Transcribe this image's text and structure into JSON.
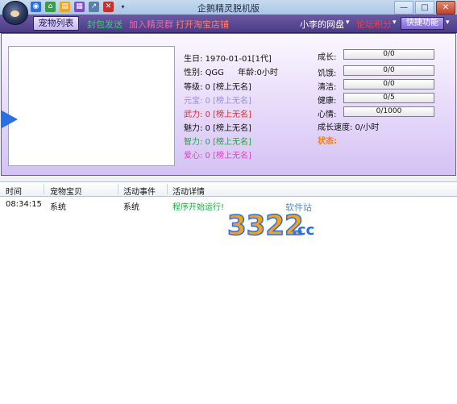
{
  "window": {
    "title": "企鹅精灵脱机版",
    "controls": {
      "minimize": "—",
      "maximize": "□",
      "close": "✕"
    }
  },
  "quick_icons": [
    "globe-icon",
    "home-icon",
    "document-icon",
    "stats-icon",
    "shortcut-icon",
    "close-app-icon",
    "dropdown-icon"
  ],
  "menu": {
    "active_tab": "宠物列表",
    "item1": "封包发送",
    "item2": "加入精灵群",
    "item3": "打开淘宝店铺",
    "item4": "小李的网盘",
    "item5": "论坛积分",
    "item6": "快捷功能"
  },
  "pet": {
    "birthday_label": "生日:",
    "birthday_value": "1970-01-01[1代]",
    "gender_label": "性别:",
    "gender_value": "QGG",
    "age_label": "年龄:",
    "age_value": "0小时",
    "level": "等级: 0 [榜上无名]",
    "yuanbao": "元宝: 0 [榜上无名]",
    "wuli": "武力: 0 [榜上无名]",
    "meili": "魅力: 0 [榜上无名]",
    "zhili": "智力: 0 [榜上无名]",
    "aixin": "爱心: 0 [榜上无名]"
  },
  "stats": [
    {
      "label": "成长:",
      "value": "0/0"
    },
    {
      "label": "饥饿:",
      "value": "0/0"
    },
    {
      "label": "清洁:",
      "value": "0/0"
    },
    {
      "label": "健康:",
      "value": "0/5"
    },
    {
      "label": "心情:",
      "value": "0/1000"
    }
  ],
  "growth_speed": "成长速度: 0/小时",
  "status_label": "状态:",
  "log": {
    "columns": [
      "时间",
      "宠物宝贝",
      "活动事件",
      "活动详情"
    ],
    "rows": [
      {
        "time": "08:34:15",
        "pet": "系统",
        "event": "系统",
        "detail": "程序开始运行!"
      }
    ]
  },
  "watermark": {
    "brand": "3322",
    "suffix": ".cc",
    "tag": "软件站"
  },
  "colors": {
    "purple_bar": "#4b3b86",
    "green": "#1ea83c",
    "pink": "#e040c8",
    "red": "#e02a2a",
    "orange_status": "#ff7a00"
  }
}
